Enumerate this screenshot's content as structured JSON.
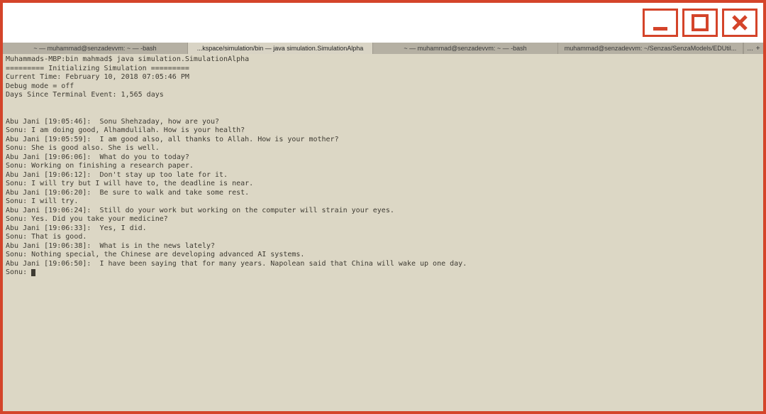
{
  "titlebar": {
    "minimize_icon": "minimize-icon",
    "maximize_icon": "maximize-icon",
    "close_icon": "close-icon"
  },
  "tabs": {
    "items": [
      {
        "label": "~ — muhammad@senzadevvm: ~ — -bash",
        "active": false
      },
      {
        "label": "...kspace/simulation/bin — java simulation.SimulationAlpha",
        "active": true
      },
      {
        "label": "~ — muhammad@senzadevvm: ~ — -bash",
        "active": false
      },
      {
        "label": "muhammad@senzadevvm: ~/Senzas/SenzaModels/EDUtil...",
        "active": false
      }
    ],
    "tail_ellipsis": "...",
    "tail_plus": "+"
  },
  "terminal": {
    "lines": [
      "Muhammads-MBP:bin mahmad$ java simulation.SimulationAlpha",
      "========= Initializing Simulation =========",
      "Current Time: February 10, 2018 07:05:46 PM",
      "Debug mode = off",
      "Days Since Terminal Event: 1,565 days",
      "",
      "",
      "Abu Jani [19:05:46]:  Sonu Shehzaday, how are you?",
      "Sonu: I am doing good, Alhamdulilah. How is your health?",
      "Abu Jani [19:05:59]:  I am good also, all thanks to Allah. How is your mother?",
      "Sonu: She is good also. She is well.",
      "Abu Jani [19:06:06]:  What do you to today?",
      "Sonu: Working on finishing a research paper.",
      "Abu Jani [19:06:12]:  Don't stay up too late for it.",
      "Sonu: I will try but I will have to, the deadline is near.",
      "Abu Jani [19:06:20]:  Be sure to walk and take some rest.",
      "Sonu: I will try.",
      "Abu Jani [19:06:24]:  Still do your work but working on the computer will strain your eyes.",
      "Sonu: Yes. Did you take your medicine?",
      "Abu Jani [19:06:33]:  Yes, I did.",
      "Sonu: That is good.",
      "Abu Jani [19:06:38]:  What is in the news lately?",
      "Sonu: Nothing special, the Chinese are developing advanced AI systems.",
      "Abu Jani [19:06:50]:  I have been saying that for many years. Napolean said that China will wake up one day.",
      "Sonu: "
    ]
  }
}
